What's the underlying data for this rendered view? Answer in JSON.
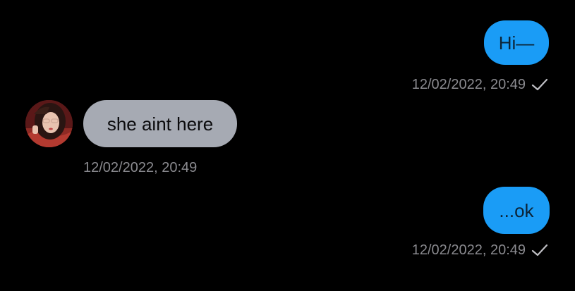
{
  "conversation": {
    "messages": [
      {
        "direction": "outgoing",
        "text": "Hi—",
        "timestamp": "12/02/2022, 20:49",
        "status_icon": "checkmark-icon"
      },
      {
        "direction": "incoming",
        "text": "she aint here",
        "timestamp": "12/02/2022, 20:49",
        "avatar": "contact-avatar"
      },
      {
        "direction": "outgoing",
        "text": "...ok",
        "timestamp": "12/02/2022, 20:49",
        "status_icon": "checkmark-icon"
      }
    ]
  },
  "colors": {
    "background": "#000000",
    "outgoing_bubble": "#1a9cf6",
    "incoming_bubble": "#a6aab3",
    "timestamp": "#8a8a8f"
  }
}
